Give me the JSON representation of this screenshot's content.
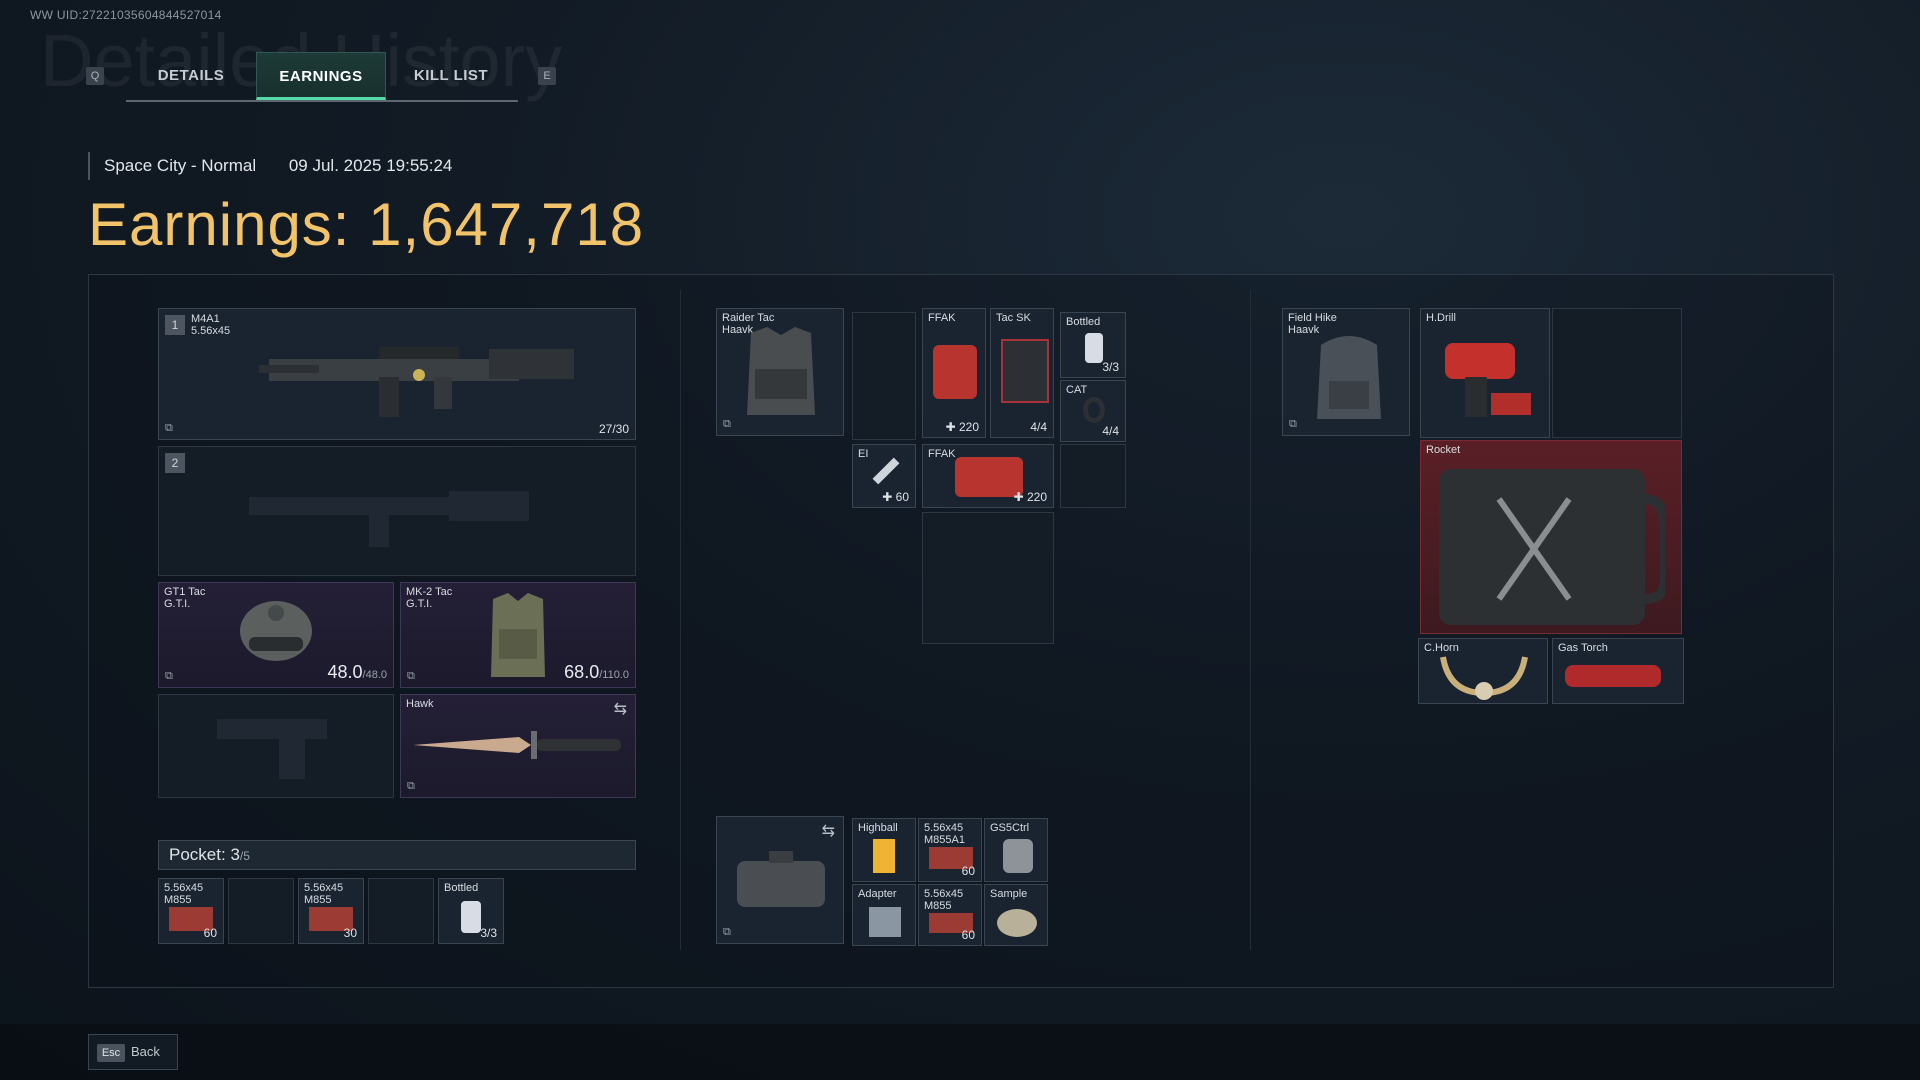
{
  "uid": "WW UID:27221035604844527014",
  "background_title": "Detailed History",
  "tabs": {
    "left_key": "Q",
    "right_key": "E",
    "items": [
      "DETAILS",
      "EARNINGS",
      "KILL LIST"
    ],
    "active": "EARNINGS"
  },
  "match": {
    "map": "Space City - Normal",
    "datetime": "09 Jul. 2025 19:55:24"
  },
  "earnings": {
    "label": "Earnings:",
    "value": "1,647,718"
  },
  "loadout": {
    "primary": {
      "slot": "1",
      "name": "M4A1",
      "caliber": "5.56x45",
      "ammo": "27/30"
    },
    "secondary": {
      "slot": "2"
    },
    "helmet": {
      "name": "GT1 Tac",
      "brand": "G.T.I.",
      "durability": "48.0",
      "max": "/48.0"
    },
    "armor": {
      "name": "MK-2 Tac",
      "brand": "G.T.I.",
      "durability": "68.0",
      "max": "/110.0"
    },
    "melee": {
      "name": "Hawk"
    },
    "pocket": {
      "label": "Pocket:",
      "count": "3",
      "max": "/5",
      "items": [
        {
          "name": "5.56x45",
          "sub": "M855",
          "qty": "60"
        },
        {
          "name": "",
          "sub": "",
          "qty": ""
        },
        {
          "name": "5.56x45",
          "sub": "M855",
          "qty": "30"
        },
        {
          "name": "",
          "sub": "",
          "qty": ""
        },
        {
          "name": "Bottled",
          "sub": "",
          "qty": "3/3"
        }
      ]
    }
  },
  "rig": {
    "name": "Raider Tac",
    "brand": "Haavk",
    "items": {
      "ffak1": {
        "name": "FFAK",
        "qty": "220"
      },
      "tacsk": {
        "name": "Tac SK",
        "qty": "4/4"
      },
      "bottled": {
        "name": "Bottled",
        "qty": "3/3"
      },
      "cat": {
        "name": "CAT",
        "qty": "4/4"
      },
      "ei": {
        "name": "EI",
        "qty": "60"
      },
      "ffak2": {
        "name": "FFAK",
        "qty": "220"
      }
    }
  },
  "case": {
    "items": {
      "highball": {
        "name": "Highball"
      },
      "ammo1": {
        "name": "5.56x45",
        "sub": "M855A1",
        "qty": "60"
      },
      "gs5": {
        "name": "GS5Ctrl"
      },
      "adapter": {
        "name": "Adapter"
      },
      "ammo2": {
        "name": "5.56x45",
        "sub": "M855",
        "qty": "60"
      },
      "sample": {
        "name": "Sample"
      }
    }
  },
  "backpack": {
    "name": "Field Hike",
    "brand": "Haavk",
    "items": {
      "hdrill": {
        "name": "H.Drill"
      },
      "rocket": {
        "name": "Rocket"
      },
      "chorn": {
        "name": "C.Horn"
      },
      "gastorch": {
        "name": "Gas Torch"
      }
    }
  },
  "footer": {
    "key": "Esc",
    "label": "Back"
  },
  "colors": {
    "accent": "#56d9a8",
    "earnings": "#f2c46a",
    "rare": "#3d3856",
    "legendary": "#7a2c34"
  }
}
